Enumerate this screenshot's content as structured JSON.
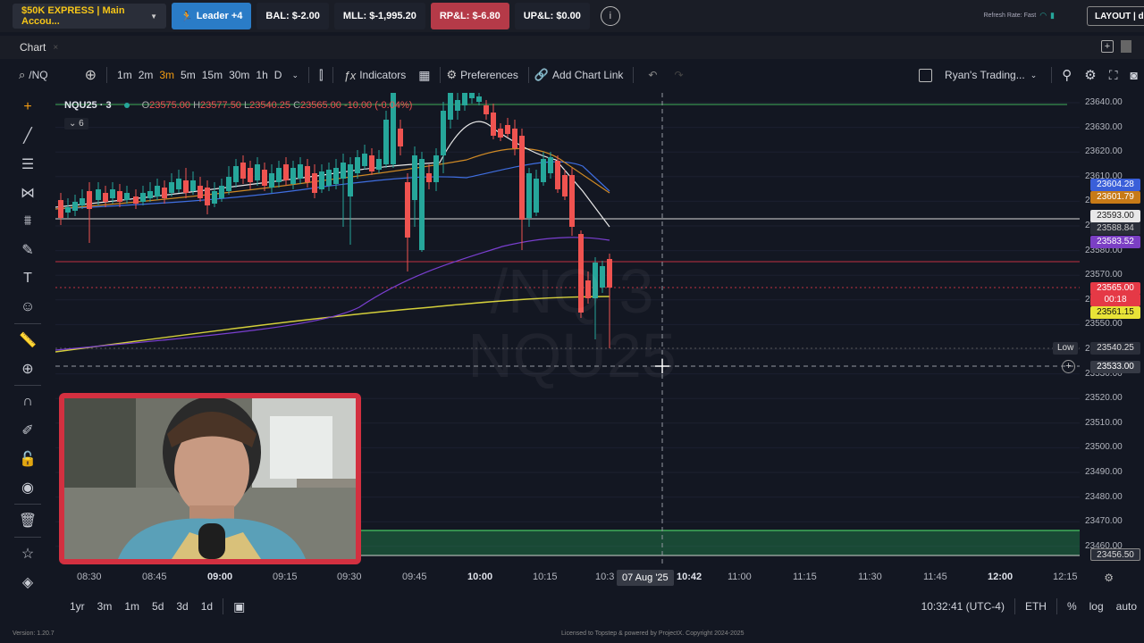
{
  "topbar": {
    "account": "$50K EXPRESS | Main Accou...",
    "leader": "Leader +4",
    "balance": "BAL: $-2.00",
    "mll": "MLL: $-1,995.20",
    "rpnl": "RP&L: $-6.80",
    "upnl": "UP&L: $0.00",
    "refresh": "Refresh Rate: Fast",
    "layout": "LAYOUT | de"
  },
  "tabrow": {
    "tab": "Chart",
    "tab_close": "×"
  },
  "toolbar": {
    "symbol": "/NQ",
    "intervals": [
      "1m",
      "2m",
      "3m",
      "5m",
      "15m",
      "30m",
      "1h",
      "D"
    ],
    "indicators": "Indicators",
    "preferences": "Preferences",
    "add_chart_link": "Add Chart Link",
    "layout_name": "Ryan's Trading..."
  },
  "legend": {
    "symbol": "NQU25 · 3",
    "o_label": "O",
    "o": "23575.00",
    "h_label": "H",
    "h": "23577.50",
    "l_label": "L",
    "l": "23540.25",
    "c_label": "C",
    "c": "23565.00",
    "chg": "-10.00 (-0.04%)",
    "sub": "6"
  },
  "watermark": {
    "line1": "/NQ 3",
    "line2": "NQU25"
  },
  "price_ticks": [
    "23640.00",
    "23630.00",
    "23620.00",
    "23610.00",
    "23600.00",
    "23590.00",
    "23580.00",
    "23570.00",
    "23560.00",
    "23550.00",
    "23540.00",
    "23530.00",
    "23520.00",
    "23510.00",
    "23500.00",
    "23490.00",
    "23480.00",
    "23470.00",
    "23460.00"
  ],
  "price_labels": {
    "blue": "23604.28",
    "orange": "23601.79",
    "white": "23593.00",
    "gray": "23588.84",
    "purple": "23583.52",
    "current": "23565.00",
    "countdown": "00:18",
    "yellow": "23561.15",
    "low_label": "Low",
    "low": "23540.25",
    "cursor": "23533.00",
    "bottom": "23456.50"
  },
  "time_ticks": [
    "08:30",
    "08:45",
    "09:00",
    "09:15",
    "09:30",
    "09:45",
    "10:00",
    "10:15",
    "10:3",
    "10:42",
    "11:00",
    "11:15",
    "11:30",
    "11:45",
    "12:00",
    "12:15"
  ],
  "cursor_date": "07 Aug '25",
  "bottombar": {
    "ranges": [
      "1yr",
      "3m",
      "1m",
      "5d",
      "3d",
      "1d"
    ],
    "clock": "10:32:41 (UTC-4)",
    "session": "ETH",
    "pct": "%",
    "log": "log",
    "auto": "auto"
  },
  "footer": {
    "version": "Version: 1.20.7",
    "license": "Licensed to Topstep & powered by ProjectX. Copyright 2024-2025"
  },
  "colors": {
    "bull": "#26a69a",
    "bear": "#ef5350",
    "accent": "#f39c12"
  }
}
